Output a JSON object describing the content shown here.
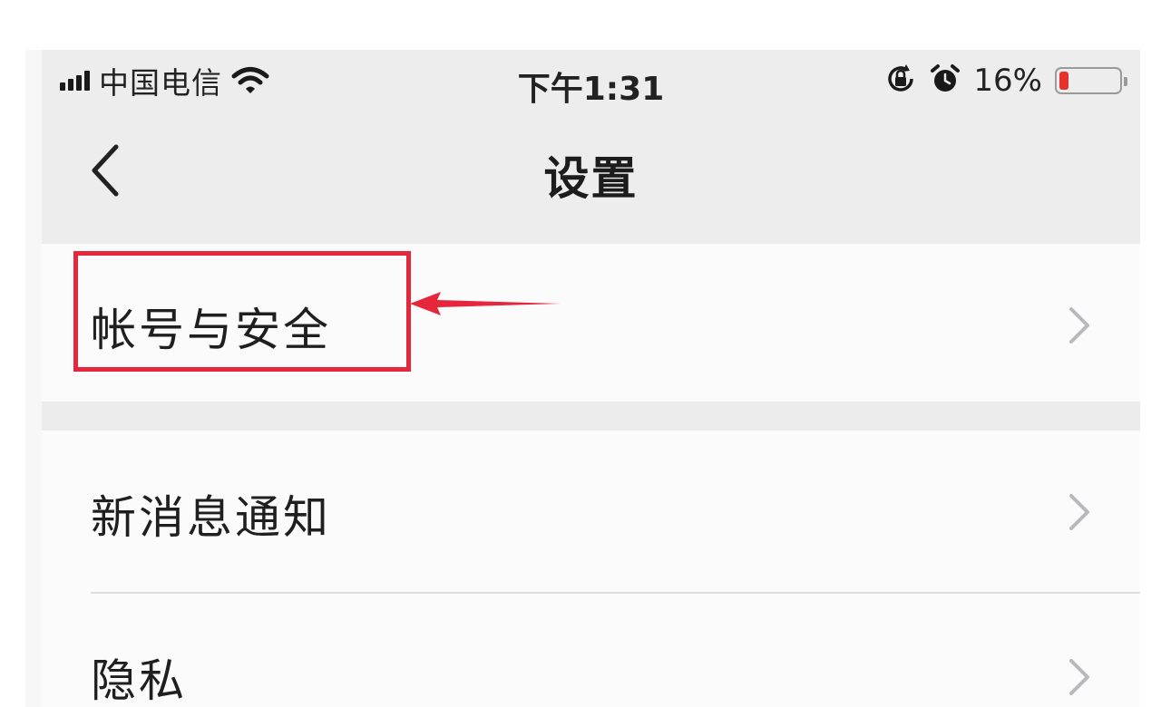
{
  "status_bar": {
    "carrier": "中国电信",
    "time": "下午1:31",
    "battery_percent": "16%",
    "battery_level": 0.16,
    "icons": [
      "signal-icon",
      "wifi-icon",
      "orientation-lock-icon",
      "alarm-icon",
      "battery-icon"
    ]
  },
  "nav": {
    "title": "设置",
    "back_icon": "chevron-left-icon"
  },
  "settings": {
    "items": [
      {
        "label": "帐号与安全",
        "icon": "chevron-right-icon"
      },
      {
        "label": "新消息通知",
        "icon": "chevron-right-icon"
      },
      {
        "label": "隐私",
        "icon": "chevron-right-icon"
      }
    ]
  },
  "annotation": {
    "color": "#e6263a",
    "target": "帐号与安全"
  },
  "colors": {
    "chrome_bg": "#ededee",
    "cell_bg": "#fbfbfc",
    "battery_low": "#e8312b"
  }
}
